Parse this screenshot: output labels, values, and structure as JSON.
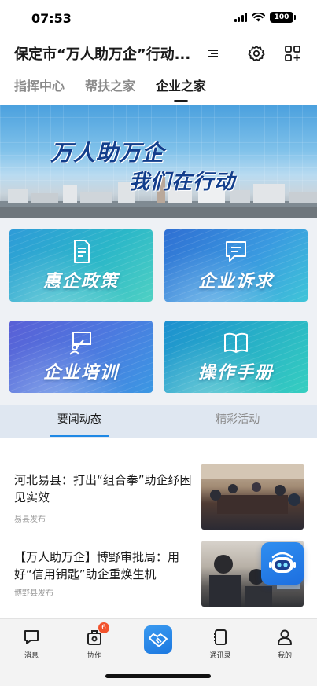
{
  "status_bar": {
    "time": "07:53",
    "battery": "100"
  },
  "header": {
    "title": "保定市“万人助万企”行动...",
    "icons": [
      "menu-icon",
      "gear-icon",
      "grid-add-icon"
    ]
  },
  "top_tabs": [
    {
      "label": "指挥中心",
      "active": false
    },
    {
      "label": "帮扶之家",
      "active": false
    },
    {
      "label": "企业之家",
      "active": true
    }
  ],
  "hero": {
    "line1": "万人助万企",
    "line2": "我们在行动"
  },
  "tiles": [
    {
      "label": "惠企政策",
      "icon": "document-icon"
    },
    {
      "label": "企业诉求",
      "icon": "chat-icon"
    },
    {
      "label": "企业培训",
      "icon": "training-icon"
    },
    {
      "label": "操作手册",
      "icon": "book-icon"
    }
  ],
  "news_tabs": [
    {
      "label": "要闻动态",
      "active": true
    },
    {
      "label": "精彩活动",
      "active": false
    }
  ],
  "news": [
    {
      "title": "河北易县：打出“组合拳”助企纾困见实效",
      "meta": "易县发布"
    },
    {
      "title": "【万人助万企】博野审批局：用好“信用钥匙”助企重焕生机",
      "meta": "博野县发布"
    }
  ],
  "bottom_nav": [
    {
      "label": "消息",
      "icon": "message-icon"
    },
    {
      "label": "协作",
      "icon": "collab-icon",
      "badge": "6"
    },
    {
      "label": "",
      "icon": "handshake-icon"
    },
    {
      "label": "通讯录",
      "icon": "contacts-icon"
    },
    {
      "label": "我的",
      "icon": "profile-icon"
    }
  ],
  "colors": {
    "accent": "#1e88e5",
    "badge": "#f2532d",
    "hero_text": "#123e8c"
  }
}
